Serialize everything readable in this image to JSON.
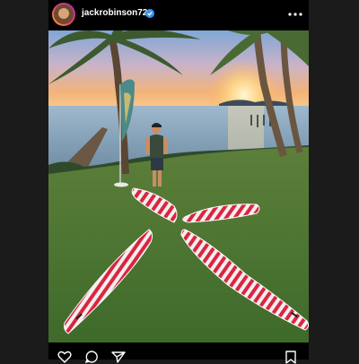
{
  "post": {
    "username": "jackrobinson72",
    "verified": true
  },
  "icons": {
    "avatar": "profile-avatar",
    "verified": "verified-badge-icon",
    "more": "more-options-icon",
    "like": "heart-icon",
    "comment": "comment-icon",
    "share": "paper-plane-icon",
    "save": "bookmark-icon"
  },
  "colors": {
    "page_bg": "#1b1b1b",
    "post_bg": "#000000",
    "verified_blue": "#3897f0",
    "board_red": "#d9263f"
  }
}
